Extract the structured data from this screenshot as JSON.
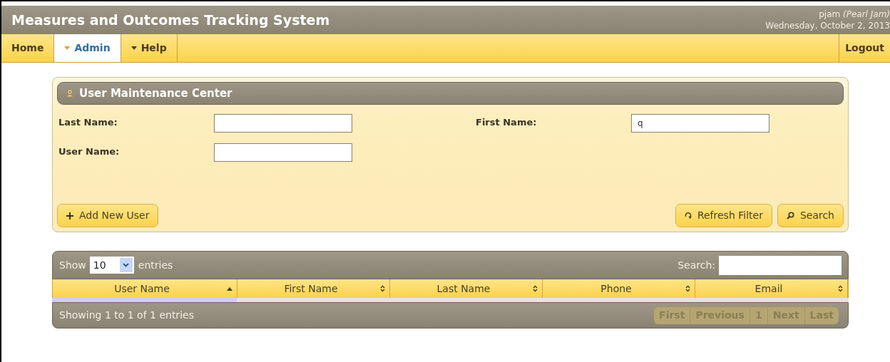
{
  "header": {
    "title": "Measures and Outcomes Tracking System",
    "user": "pjam *(Pearl Jam)*",
    "date": "Wednesday, October 2, 2013"
  },
  "nav": [
    {
      "label": "Home",
      "kind": "link",
      "selected": false
    },
    {
      "label": "Admin",
      "kind": "menu",
      "selected": true
    },
    {
      "label": "Help",
      "kind": "menu",
      "selected": false
    }
  ],
  "logout": "Logout",
  "panel": {
    "title": "User Maintenance Center",
    "fields": [
      {
        "label": "Last Name:"
      },
      {
        "label": "First Name:",
        "value": "q"
      },
      {
        "label": "User Name:"
      }
    ],
    "add_button": "Add New User",
    "refresh_button": "Refresh Filter",
    "search_button": "Search"
  },
  "table": {
    "show_label": "Show",
    "page_size": "10",
    "entries_label": "entries",
    "search_label": "Search:",
    "columns": [
      {
        "label": "User Name",
        "sorted": true
      },
      {
        "label": "First Name",
        "sorted": false
      },
      {
        "label": "Last Name",
        "sorted": false
      },
      {
        "label": "Phone",
        "sorted": false
      },
      {
        "label": "Email",
        "sorted": false
      }
    ],
    "info": "Showing 1 to 1 of 1 entries",
    "pagination": [
      {
        "label": "First",
        "disabled": true
      },
      {
        "label": "Previous",
        "disabled": true
      },
      {
        "label": "1",
        "disabled": true
      },
      {
        "label": "Next",
        "disabled": true
      },
      {
        "label": "Last",
        "disabled": true
      }
    ]
  }
}
